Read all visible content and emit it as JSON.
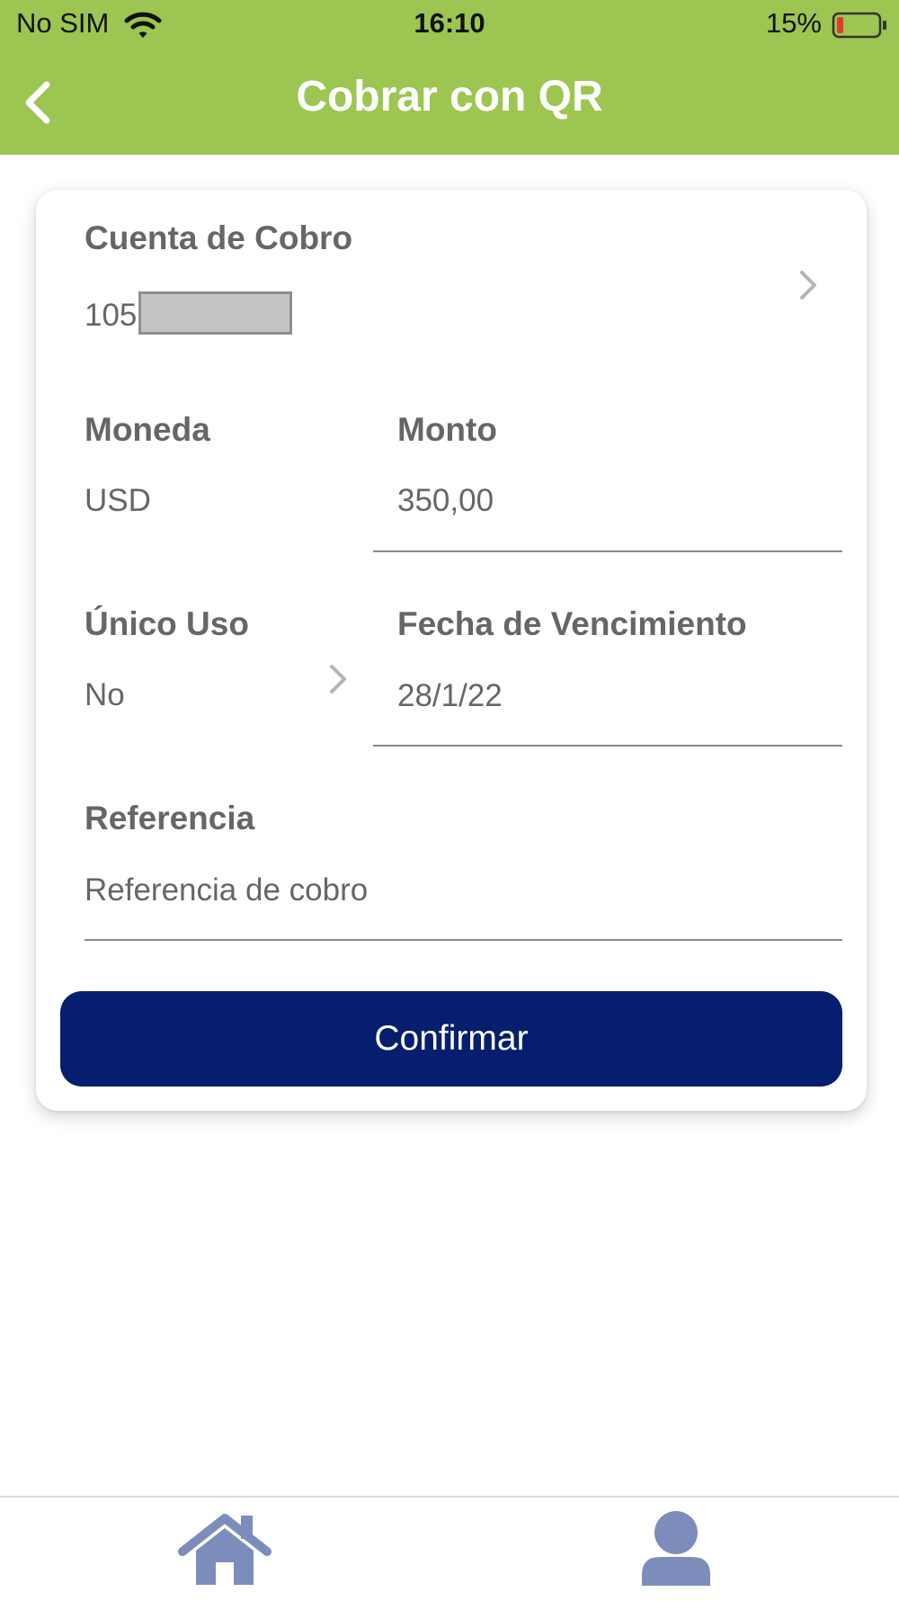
{
  "status_bar": {
    "carrier": "No SIM",
    "time": "16:10",
    "battery": "15%",
    "wifi_icon": "wifi-icon",
    "battery_icon": "battery-low-icon"
  },
  "header": {
    "title": "Cobrar con QR",
    "back_icon": "chevron-left-icon",
    "color": "#9dc551"
  },
  "form": {
    "account": {
      "label": "Cuenta de Cobro",
      "value": "105"
    },
    "currency": {
      "label": "Moneda",
      "value": "USD"
    },
    "amount": {
      "label": "Monto",
      "value": "350,00"
    },
    "single_use": {
      "label": "Único Uso",
      "value": "No"
    },
    "due_date": {
      "label": "Fecha de Vencimiento",
      "value": "28/1/22"
    },
    "reference": {
      "label": "Referencia",
      "placeholder": "Referencia de cobro"
    },
    "confirm_label": "Confirmar",
    "confirm_color": "#061e6e"
  },
  "tab_bar": {
    "items": [
      {
        "icon": "home-icon"
      },
      {
        "icon": "user-icon"
      }
    ],
    "icon_color": "#7d8dbb"
  }
}
